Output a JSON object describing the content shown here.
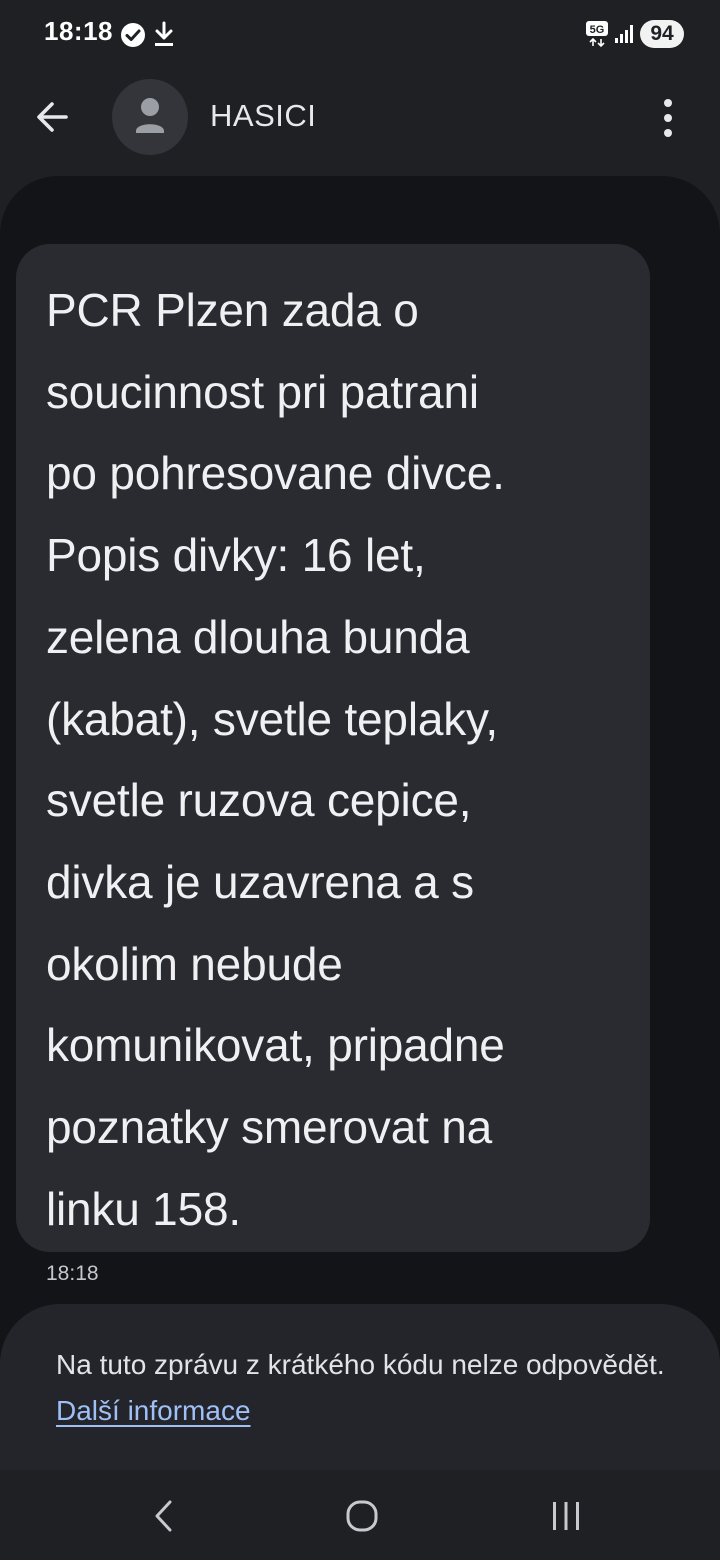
{
  "status_bar": {
    "time": "18:18",
    "network": "5G",
    "battery": "94",
    "icons": [
      "check-circle-icon",
      "download-icon",
      "5g-icon",
      "signal-icon",
      "battery-icon"
    ]
  },
  "header": {
    "contact_name": "HASICI",
    "icons": [
      "back-arrow-icon",
      "person-icon",
      "more-vert-icon"
    ]
  },
  "messages": [
    {
      "text": "PCR Plzen zada o\nsoucinnost pri patrani\npo pohresovane divce.\nPopis divky: 16 let,\nzelena dlouha bunda\n(kabat), svetle teplaky,\nsvetle ruzova cepice,\ndivka je uzavrena a s\nokolim nebude\nkomunikovat, pripadne\npoznatky smerovat na\nlinku 158.",
      "time": "18:18"
    }
  ],
  "footer": {
    "notice": "Na tuto zprávu z krátkého kódu nelze odpovědět.",
    "link": "Další informace"
  },
  "nav_bar": {
    "icons": [
      "nav-back-icon",
      "nav-home-icon",
      "nav-recents-icon"
    ]
  },
  "colors": {
    "background": "#1f2024",
    "conversation_bg": "#131417",
    "bubble": "#2a2b30",
    "link": "#9fc0f7"
  }
}
